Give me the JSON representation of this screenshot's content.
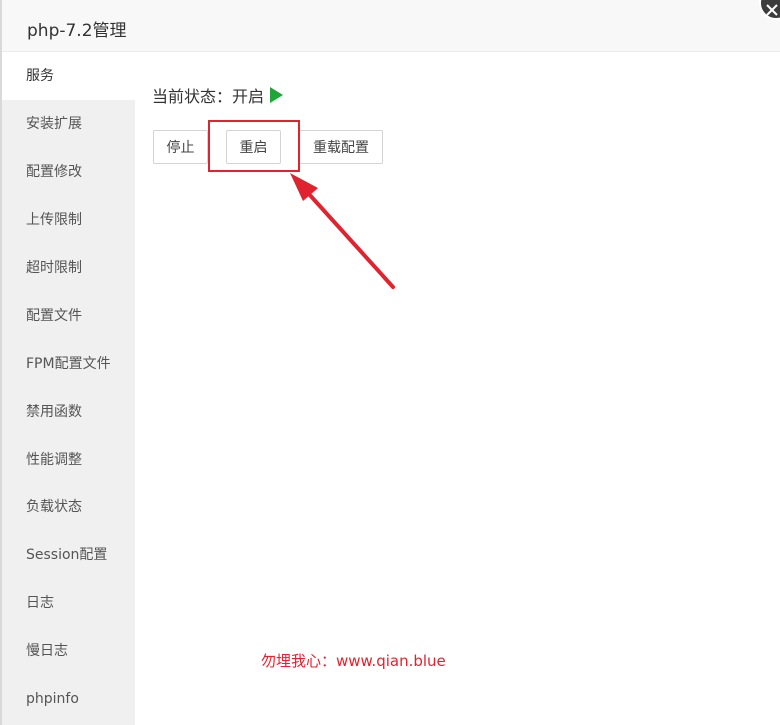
{
  "window": {
    "title": "php-7.2管理"
  },
  "sidebar": {
    "items": [
      {
        "label": "服务",
        "active": true
      },
      {
        "label": "安装扩展"
      },
      {
        "label": "配置修改"
      },
      {
        "label": "上传限制"
      },
      {
        "label": "超时限制"
      },
      {
        "label": "配置文件"
      },
      {
        "label": "FPM配置文件"
      },
      {
        "label": "禁用函数"
      },
      {
        "label": "性能调整"
      },
      {
        "label": "负载状态"
      },
      {
        "label": "Session配置"
      },
      {
        "label": "日志"
      },
      {
        "label": "慢日志"
      },
      {
        "label": "phpinfo"
      }
    ]
  },
  "service": {
    "status_label": "当前状态：",
    "status_value": "开启",
    "status_icon": "play-icon",
    "status_color": "#20a53a",
    "buttons": {
      "stop": "停止",
      "restart": "重启",
      "reload": "重载配置"
    }
  },
  "annotation": {
    "watermark": "勿埋我心：www.qian.blue",
    "color": "#e0232f"
  }
}
